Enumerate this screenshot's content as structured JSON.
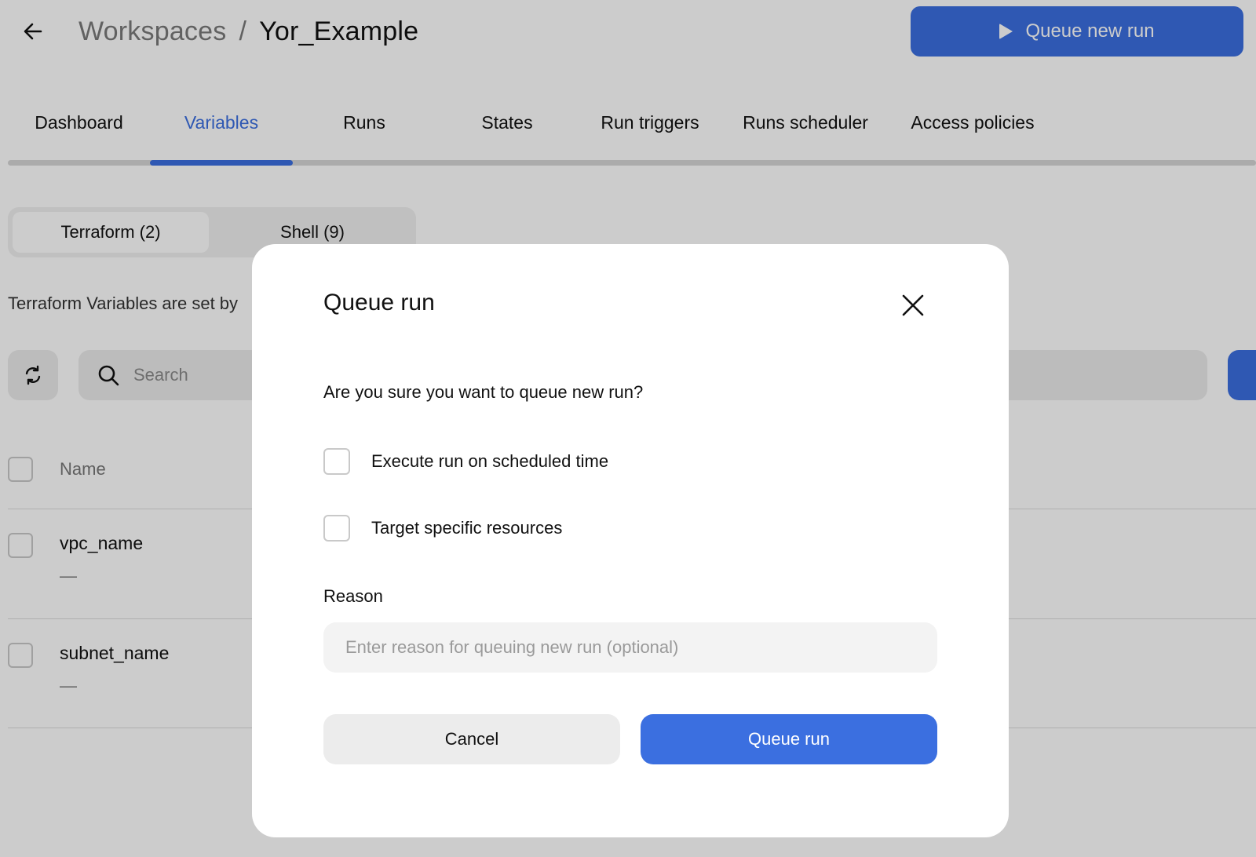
{
  "header": {
    "breadcrumb_parent": "Workspaces",
    "breadcrumb_separator": "/",
    "breadcrumb_current": "Yor_Example",
    "queue_new_run_label": "Queue new run"
  },
  "tabs": [
    {
      "label": "Dashboard",
      "active": false
    },
    {
      "label": "Variables",
      "active": true
    },
    {
      "label": "Runs",
      "active": false
    },
    {
      "label": "States",
      "active": false
    },
    {
      "label": "Run triggers",
      "active": false
    },
    {
      "label": "Runs scheduler",
      "active": false
    },
    {
      "label": "Access policies",
      "active": false
    }
  ],
  "variable_types": [
    {
      "label": "Terraform (2)",
      "active": true
    },
    {
      "label": "Shell (9)",
      "active": false
    }
  ],
  "description": "Terraform Variables are set by",
  "search": {
    "placeholder": "Search"
  },
  "table": {
    "columns": [
      "Name"
    ],
    "rows": [
      {
        "name": "vpc_name",
        "description": "—"
      },
      {
        "name": "subnet_name",
        "description": "—"
      }
    ]
  },
  "modal": {
    "title": "Queue run",
    "question": "Are you sure you want to queue new run?",
    "options": [
      {
        "label": "Execute run on scheduled time",
        "checked": false
      },
      {
        "label": "Target specific resources",
        "checked": false
      }
    ],
    "reason_label": "Reason",
    "reason_placeholder": "Enter reason for queuing new run (optional)",
    "cancel_label": "Cancel",
    "confirm_label": "Queue run"
  },
  "colors": {
    "accent": "#3b6fe0",
    "overlay": "rgba(0,0,0,0.2)"
  },
  "icons": [
    "arrow-left-icon",
    "play-icon",
    "refresh-icon",
    "search-icon",
    "close-icon"
  ]
}
